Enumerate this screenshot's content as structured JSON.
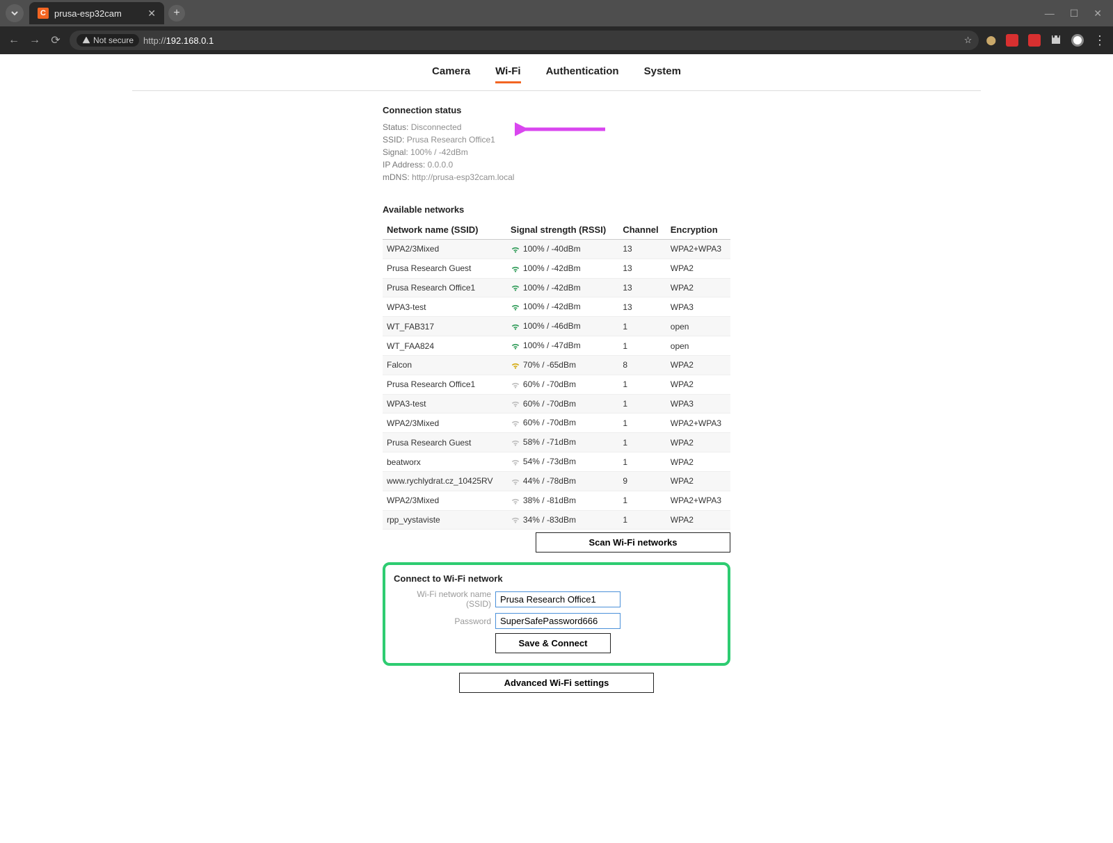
{
  "browser": {
    "tab_title": "prusa-esp32cam",
    "security_label": "Not secure",
    "url_scheme": "http://",
    "url_host": "192.168.0.1"
  },
  "tabs": {
    "items": [
      "Camera",
      "Wi-Fi",
      "Authentication",
      "System"
    ],
    "active_index": 1
  },
  "status": {
    "heading": "Connection status",
    "rows": [
      {
        "label": "Status:",
        "value": "Disconnected"
      },
      {
        "label": "SSID:",
        "value": "Prusa Research Office1"
      },
      {
        "label": "Signal:",
        "value": "100% / -42dBm"
      },
      {
        "label": "IP Address:",
        "value": "0.0.0.0"
      },
      {
        "label": "mDNS:",
        "value": "http://prusa-esp32cam.local"
      }
    ]
  },
  "networks": {
    "heading": "Available networks",
    "columns": [
      "Network name (SSID)",
      "Signal strength (RSSI)",
      "Channel",
      "Encryption"
    ],
    "rows": [
      {
        "ssid": "WPA2/3Mixed",
        "rssi": "100% / -40dBm",
        "channel": "13",
        "enc": "WPA2+WPA3",
        "strength": "green"
      },
      {
        "ssid": "Prusa Research Guest",
        "rssi": "100% / -42dBm",
        "channel": "13",
        "enc": "WPA2",
        "strength": "green"
      },
      {
        "ssid": "Prusa Research Office1",
        "rssi": "100% / -42dBm",
        "channel": "13",
        "enc": "WPA2",
        "strength": "green"
      },
      {
        "ssid": "WPA3-test",
        "rssi": "100% / -42dBm",
        "channel": "13",
        "enc": "WPA3",
        "strength": "green"
      },
      {
        "ssid": "WT_FAB317",
        "rssi": "100% / -46dBm",
        "channel": "1",
        "enc": "open",
        "strength": "green"
      },
      {
        "ssid": "WT_FAA824",
        "rssi": "100% / -47dBm",
        "channel": "1",
        "enc": "open",
        "strength": "green"
      },
      {
        "ssid": "Falcon",
        "rssi": "70% / -65dBm",
        "channel": "8",
        "enc": "WPA2",
        "strength": "yellow"
      },
      {
        "ssid": "Prusa Research Office1",
        "rssi": "60% / -70dBm",
        "channel": "1",
        "enc": "WPA2",
        "strength": "grey"
      },
      {
        "ssid": "WPA3-test",
        "rssi": "60% / -70dBm",
        "channel": "1",
        "enc": "WPA3",
        "strength": "grey"
      },
      {
        "ssid": "WPA2/3Mixed",
        "rssi": "60% / -70dBm",
        "channel": "1",
        "enc": "WPA2+WPA3",
        "strength": "grey"
      },
      {
        "ssid": "Prusa Research Guest",
        "rssi": "58% / -71dBm",
        "channel": "1",
        "enc": "WPA2",
        "strength": "grey"
      },
      {
        "ssid": "beatworx",
        "rssi": "54% / -73dBm",
        "channel": "1",
        "enc": "WPA2",
        "strength": "grey"
      },
      {
        "ssid": "www.rychlydrat.cz_10425RV",
        "rssi": "44% / -78dBm",
        "channel": "9",
        "enc": "WPA2",
        "strength": "grey"
      },
      {
        "ssid": "WPA2/3Mixed",
        "rssi": "38% / -81dBm",
        "channel": "1",
        "enc": "WPA2+WPA3",
        "strength": "grey"
      },
      {
        "ssid": "rpp_vystaviste",
        "rssi": "34% / -83dBm",
        "channel": "1",
        "enc": "WPA2",
        "strength": "grey"
      }
    ]
  },
  "buttons": {
    "scan": "Scan Wi-Fi networks",
    "advanced": "Advanced Wi-Fi settings",
    "save_connect": "Save & Connect"
  },
  "connect": {
    "heading": "Connect to Wi-Fi network",
    "ssid_label": "Wi-Fi network name (SSID)",
    "ssid_value": "Prusa Research Office1",
    "password_label": "Password",
    "password_value": "SuperSafePassword666"
  },
  "annotation": {
    "arrow_color": "#d946ef"
  }
}
